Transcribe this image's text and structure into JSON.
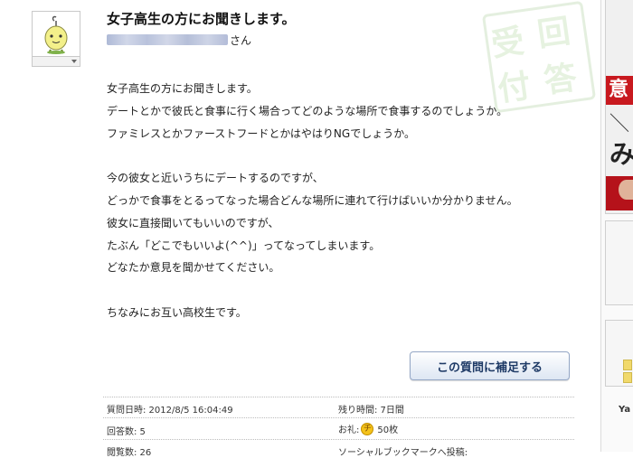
{
  "question": {
    "title": "女子高生の方にお聞きします。",
    "user_suffix": "さん",
    "body_lines": [
      "女子高生の方にお聞きします。",
      "デートとかで彼氏と食事に行く場合ってどのような場所で食事するのでしょうか。",
      "ファミレスとかファーストフードとかはやはりNGでしょうか。",
      "",
      "今の彼女と近いうちにデートするのですが、",
      "どっかで食事をとるってなった場合どんな場所に連れて行けばいいか分かりません。",
      "彼女に直接聞いてもいいのですが、",
      "たぶん「どこでもいいよ(^^)」ってなってしまいます。",
      "どなたか意見を聞かせてください。",
      "",
      "ちなみにお互い高校生です。"
    ],
    "supplement_button": "この質問に補足する"
  },
  "stamp": {
    "chars": [
      "受",
      "回",
      "付",
      "答"
    ]
  },
  "meta": {
    "asked_at": "質問日時: 2012/8/5 16:04:49",
    "remaining": "残り時間: 7日間",
    "answer_count": "回答数: 5",
    "reward_label": "お礼:",
    "reward_coin": "チ",
    "reward_value": "50枚",
    "views_partial": "閲覧数: 26",
    "social_partial": "ソーシャルブックマークへ投稿:"
  },
  "sidebar": {
    "ad_red_char": "意",
    "ad_slash": "＼",
    "ad_char": "み",
    "label_partial": "Ya"
  },
  "colors": {
    "title": "#111111",
    "button_text": "#1e3a66",
    "button_border": "#94a7c6",
    "stamp": "#cfe3c5",
    "coin": "#f4c21a"
  }
}
